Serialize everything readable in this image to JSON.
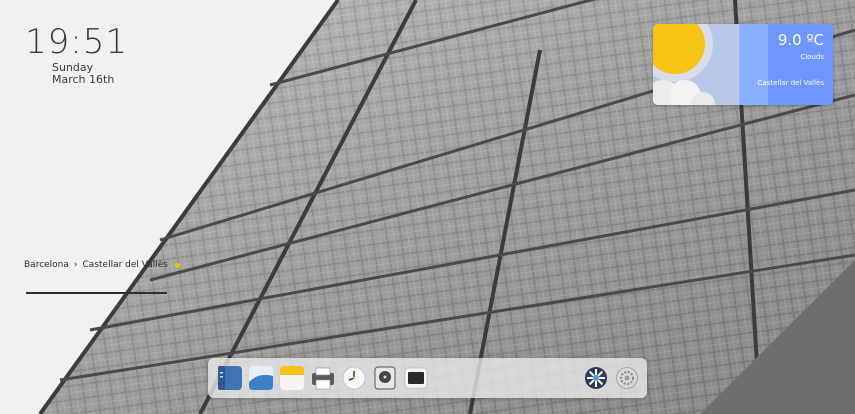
{
  "clock": {
    "time": "19:51",
    "day": "Sunday",
    "date": "March 16th"
  },
  "location": {
    "region": "Barcelona",
    "separator": "›",
    "city": "Castellar del Vallès"
  },
  "weather": {
    "temperature": "9.0 ºC",
    "condition": "Clouds",
    "location": "Castellar del Vallès",
    "colors": {
      "background": "#6e96ff",
      "sun": "#f6c214",
      "cloud": "#e9e9e9"
    }
  },
  "dock": {
    "apps": [
      {
        "icon": "file-manager-icon"
      },
      {
        "icon": "photos-icon"
      },
      {
        "icon": "notes-icon"
      },
      {
        "icon": "printer-icon"
      },
      {
        "icon": "clock-icon"
      },
      {
        "icon": "disk-icon"
      },
      {
        "icon": "terminal-icon"
      },
      {
        "icon": "app-launcher-icon"
      },
      {
        "icon": "settings-icon"
      }
    ]
  }
}
